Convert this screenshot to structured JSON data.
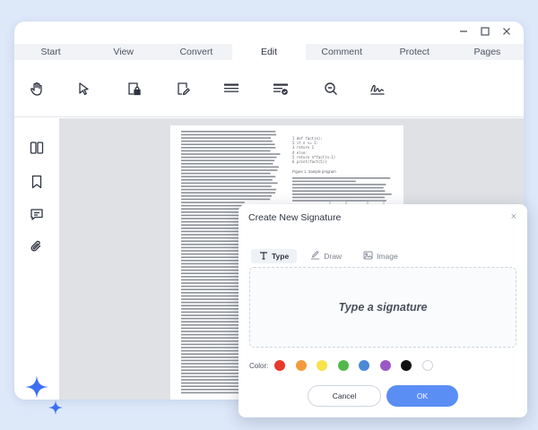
{
  "tabs": [
    {
      "label": "Start"
    },
    {
      "label": "View"
    },
    {
      "label": "Convert"
    },
    {
      "label": "Edit"
    },
    {
      "label": "Comment"
    },
    {
      "label": "Protect"
    },
    {
      "label": "Pages"
    }
  ],
  "active_tab": "Edit",
  "toolbar_icons": [
    "hand-icon",
    "cursor-icon",
    "lock-form-icon",
    "edit-file-icon",
    "text-lines-icon",
    "text-verified-icon",
    "zoom-out-icon",
    "signature-icon"
  ],
  "sidebar_icons": [
    "pages-icon",
    "bookmark-icon",
    "comment-icon",
    "attachment-icon"
  ],
  "document": {
    "code_lines": [
      "1 def fact(n):",
      "2   if n <= 1:",
      "3     return 1",
      "4   else:",
      "5     return n*fact(n-1)",
      "6 print(fact(5))"
    ],
    "figure_caption": "Figure 1. Sample program"
  },
  "dialog": {
    "title": "Create New Signature",
    "close": "×",
    "tabs": [
      {
        "label": "Type",
        "icon": "text-type-icon"
      },
      {
        "label": "Draw",
        "icon": "draw-pen-icon"
      },
      {
        "label": "Image",
        "icon": "image-icon"
      }
    ],
    "placeholder": "Type a signature",
    "color_label": "Color:",
    "colors": [
      "#e8392b",
      "#f39b3c",
      "#f7e34b",
      "#52b84a",
      "#4a88d8",
      "#9b59c6",
      "#111111",
      "#ffffff"
    ],
    "cancel_label": "Cancel",
    "ok_label": "OK"
  },
  "accent_color": "#5b8ef5"
}
